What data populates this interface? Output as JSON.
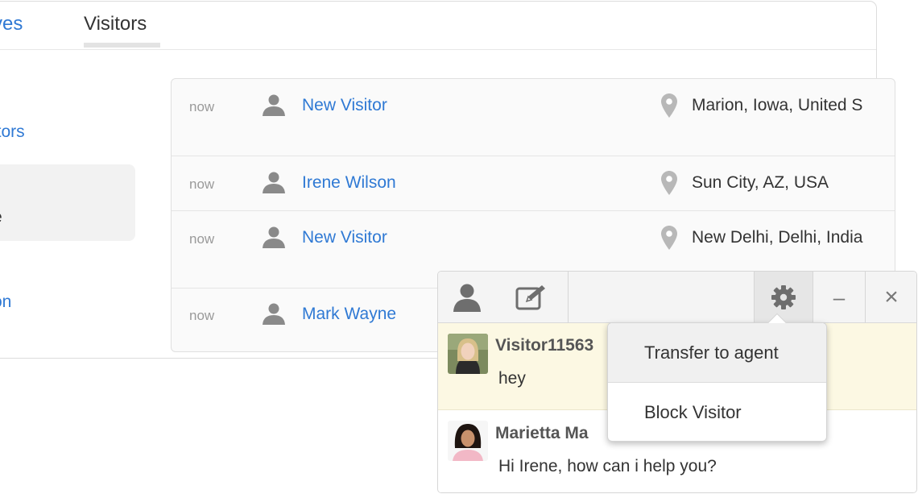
{
  "tabs": {
    "archives_partial": "ves",
    "visitors": "Visitors"
  },
  "sidebar": {
    "item1_partial": "itors",
    "item2_partial": "e",
    "item3_partial": "on"
  },
  "visitors": [
    {
      "time": "now",
      "name": "New Visitor",
      "location": "Marion, Iowa, United S"
    },
    {
      "time": "now",
      "name": "Irene Wilson",
      "location": "Sun City, AZ, USA"
    },
    {
      "time": "now",
      "name": "New Visitor",
      "location": "New Delhi, Delhi, India"
    },
    {
      "time": "now",
      "name": "Mark Wayne",
      "location": ""
    }
  ],
  "chat": {
    "messages": [
      {
        "sender": "Visitor11563",
        "text": "hey"
      },
      {
        "sender": "Marietta Ma",
        "text": "Hi Irene, how can i help you?"
      }
    ],
    "toolbar": {
      "minimize_glyph": "–",
      "close_glyph": "×"
    }
  },
  "dropdown": {
    "items": [
      "Transfer to agent",
      "Block Visitor"
    ]
  },
  "colors": {
    "link": "#2f79d4",
    "highlight": "#fcf8e3",
    "icon": "#8a8a8a"
  }
}
